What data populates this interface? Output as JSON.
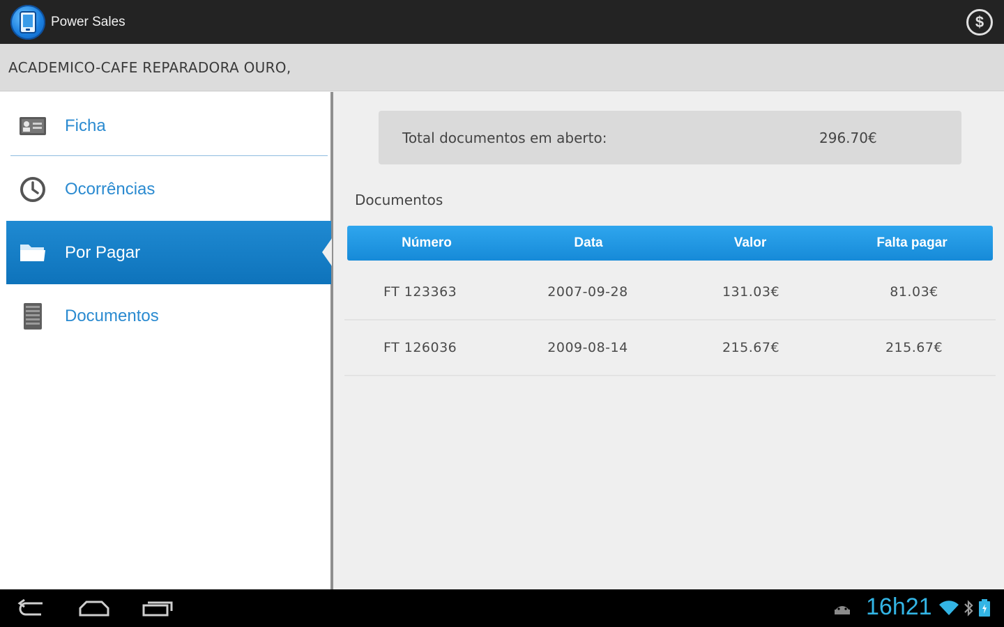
{
  "app": {
    "title": "Power Sales"
  },
  "customer": {
    "name": "ACADEMICO-CAFE REPARADORA OURO,"
  },
  "nav": {
    "items": [
      {
        "label": "Ficha",
        "icon": "id-card-icon"
      },
      {
        "label": "Ocorrências",
        "icon": "clock-icon"
      },
      {
        "label": "Por Pagar",
        "icon": "folder-icon",
        "active": true
      },
      {
        "label": "Documentos",
        "icon": "document-stack-icon"
      }
    ]
  },
  "summary": {
    "label": "Total documentos em aberto:",
    "value": "296.70€"
  },
  "documents": {
    "title": "Documentos",
    "columns": [
      "Número",
      "Data",
      "Valor",
      "Falta pagar"
    ],
    "rows": [
      [
        "FT  123363",
        "2007-09-28",
        "131.03€",
        "81.03€"
      ],
      [
        "FT  126036",
        "2009-08-14",
        "215.67€",
        "215.67€"
      ]
    ]
  },
  "system": {
    "clock": "16h21",
    "buttons": [
      "back-icon",
      "home-icon",
      "recent-apps-icon"
    ],
    "status_icons": [
      "android-icon",
      "wifi-icon",
      "bluetooth-icon",
      "battery-icon"
    ]
  },
  "colors": {
    "accent": "#168ad8",
    "nav_text": "#2a8ad0",
    "clock": "#33b5e5",
    "actionbar": "#232323"
  }
}
